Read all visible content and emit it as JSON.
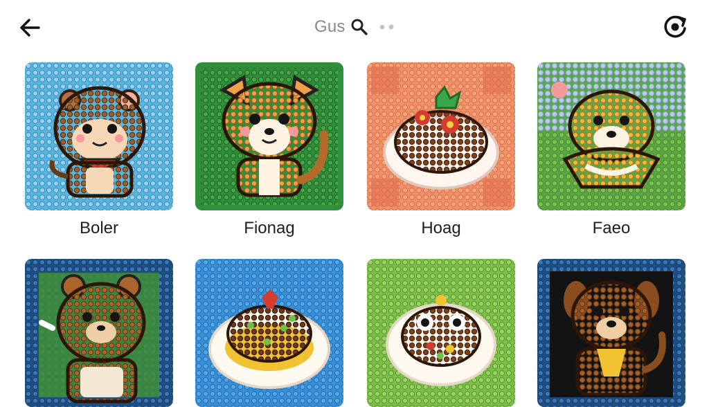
{
  "header": {
    "search_text": "Gus",
    "back_icon": "arrow-left-icon",
    "search_icon": "search-icon",
    "more_icon": "dots-icon",
    "refresh_icon": "refresh-icon"
  },
  "cards": [
    {
      "label": "Boler",
      "image": "monkey-bead-art"
    },
    {
      "label": "Fionag",
      "image": "fox-bead-art"
    },
    {
      "label": "Hoag",
      "image": "food-plate-bead-art"
    },
    {
      "label": "Faeo",
      "image": "dog-bead-art"
    },
    {
      "label": "",
      "image": "bear-bead-art"
    },
    {
      "label": "",
      "image": "dish-bead-art"
    },
    {
      "label": "",
      "image": "owl-dish-bead-art"
    },
    {
      "label": "",
      "image": "puppy-bead-art"
    }
  ],
  "colors": {
    "text": "#1e1e1e",
    "muted": "#8a8a8a",
    "tile_backgrounds": [
      "#5bb6de",
      "#2f8f3a",
      "#f0906a",
      "#5aa64a",
      "#1f4f82",
      "#3a8fd6",
      "#7cc046",
      "#1f4f82"
    ]
  }
}
